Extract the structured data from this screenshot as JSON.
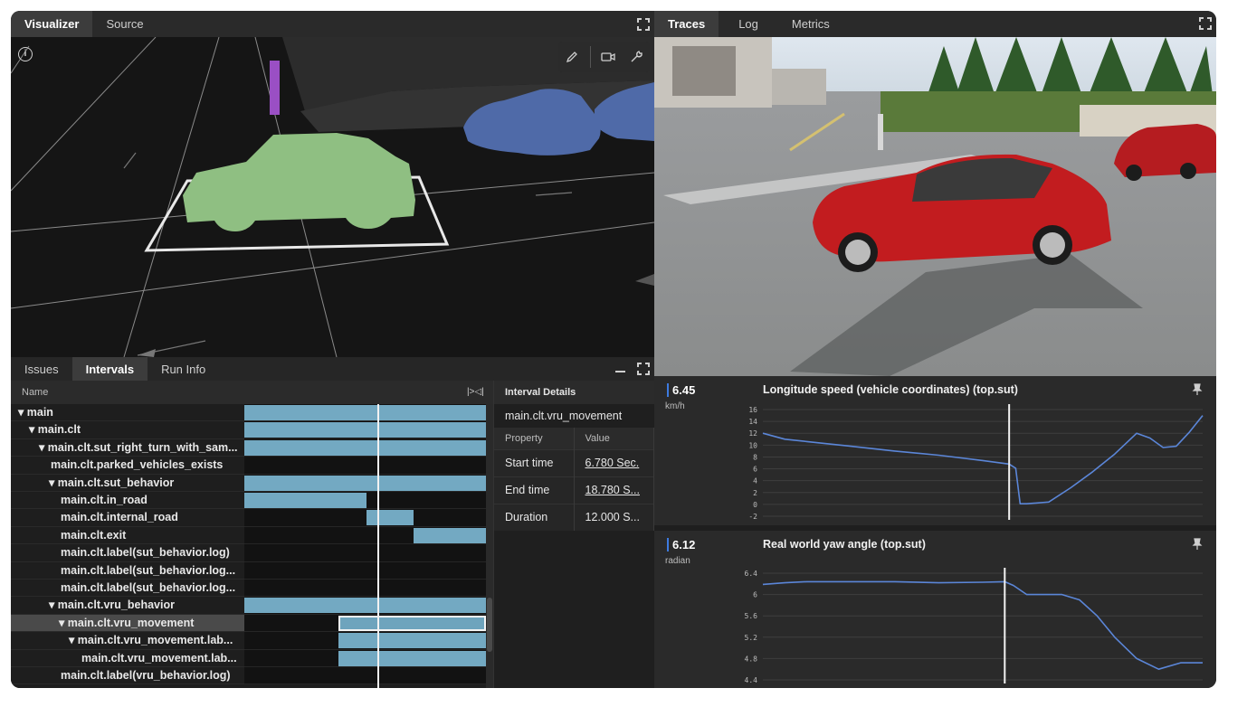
{
  "left_panel": {
    "tabs": [
      {
        "label": "Visualizer",
        "active": true
      },
      {
        "label": "Source",
        "active": false
      }
    ],
    "info_icon": "i"
  },
  "bottom_panel": {
    "tabs": [
      {
        "label": "Issues",
        "active": false
      },
      {
        "label": "Intervals",
        "active": true
      },
      {
        "label": "Run Info",
        "active": false
      }
    ],
    "name_header": "Name",
    "collapse_glyph": "|>◁|",
    "rows": [
      {
        "label": "▾ main",
        "indent": 8,
        "bars": [
          [
            0,
            1
          ]
        ]
      },
      {
        "label": "▾ main.clt",
        "indent": 20,
        "bars": [
          [
            0,
            1
          ]
        ]
      },
      {
        "label": "▾ main.clt.sut_right_turn_with_sam...",
        "indent": 31,
        "bars": [
          [
            0,
            1
          ]
        ]
      },
      {
        "label": "main.clt.parked_vehicles_exists",
        "indent": 44,
        "bars": []
      },
      {
        "label": "▾ main.clt.sut_behavior",
        "indent": 42,
        "bars": [
          [
            0,
            1
          ]
        ]
      },
      {
        "label": "main.clt.in_road",
        "indent": 55,
        "bars": [
          [
            0,
            0.505
          ]
        ]
      },
      {
        "label": "main.clt.internal_road",
        "indent": 55,
        "bars": [
          [
            0.505,
            0.7
          ]
        ]
      },
      {
        "label": "main.clt.exit",
        "indent": 55,
        "bars": [
          [
            0.7,
            1
          ]
        ]
      },
      {
        "label": "main.clt.label(sut_behavior.log)",
        "indent": 55,
        "bars": []
      },
      {
        "label": "main.clt.label(sut_behavior.log...",
        "indent": 55,
        "bars": []
      },
      {
        "label": "main.clt.label(sut_behavior.log...",
        "indent": 55,
        "bars": []
      },
      {
        "label": "▾ main.clt.vru_behavior",
        "indent": 42,
        "bars": [
          [
            0,
            1
          ]
        ]
      },
      {
        "label": "▾ main.clt.vru_movement",
        "indent": 53,
        "bars": [
          [
            0.39,
            1
          ]
        ],
        "selected": true
      },
      {
        "label": "▾ main.clt.vru_movement.lab...",
        "indent": 64,
        "bars": [
          [
            0.39,
            1
          ]
        ]
      },
      {
        "label": "main.clt.vru_movement.lab...",
        "indent": 78,
        "bars": [
          [
            0.39,
            1
          ]
        ]
      },
      {
        "label": "main.clt.label(vru_behavior.log)",
        "indent": 55,
        "bars": []
      }
    ],
    "details": {
      "header": "Interval Details",
      "name": "main.clt.vru_movement",
      "col_property": "Property",
      "col_value": "Value",
      "rows": [
        {
          "property": "Start time",
          "value": "6.780 Sec."
        },
        {
          "property": "End time",
          "value": "18.780 S..."
        },
        {
          "property": "Duration",
          "value": "12.000 S..."
        }
      ]
    }
  },
  "right_panel": {
    "tabs": [
      {
        "label": "Traces",
        "active": true
      },
      {
        "label": "Log",
        "active": false
      },
      {
        "label": "Metrics",
        "active": false
      }
    ]
  },
  "charts": [
    {
      "current_value": "6.45",
      "unit": "km/h",
      "title": "Longitude speed (vehicle coordinates) (top.sut)",
      "y_ticks": [
        "16",
        "14",
        "12",
        "10",
        "8",
        "6",
        "4",
        "2",
        "0",
        "-2"
      ],
      "line_color": "#5b86d8"
    },
    {
      "current_value": "6.12",
      "unit": "radian",
      "title": "Real world yaw angle (top.sut)",
      "y_ticks": [
        "6.4",
        "6",
        "5.6",
        "5.2",
        "4.8",
        "4.4"
      ],
      "line_color": "#5b86d8"
    }
  ],
  "chart_data": [
    {
      "type": "line",
      "title": "Longitude speed (vehicle coordinates) (top.sut)",
      "ylabel": "km/h",
      "ylim": [
        -2,
        16
      ],
      "x": [
        0,
        0.05,
        0.1,
        0.2,
        0.3,
        0.4,
        0.5,
        0.56,
        0.575,
        0.585,
        0.6,
        0.65,
        0.7,
        0.75,
        0.8,
        0.85,
        0.88,
        0.91,
        0.94,
        0.97,
        1.0
      ],
      "series": [
        {
          "values": [
            12.0,
            11.0,
            10.6,
            9.8,
            9.0,
            8.3,
            7.4,
            6.8,
            6.1,
            0.1,
            0.1,
            0.4,
            2.8,
            5.5,
            8.5,
            12.0,
            11.2,
            9.6,
            9.8,
            12.2,
            15.0
          ]
        }
      ],
      "cursor_x": 0.56,
      "grid": true
    },
    {
      "type": "line",
      "title": "Real world yaw angle (top.sut)",
      "ylabel": "radian",
      "ylim": [
        4.4,
        6.4
      ],
      "x": [
        0,
        0.05,
        0.1,
        0.2,
        0.3,
        0.4,
        0.5,
        0.55,
        0.57,
        0.6,
        0.65,
        0.68,
        0.72,
        0.76,
        0.8,
        0.85,
        0.9,
        0.95,
        1.0
      ],
      "series": [
        {
          "values": [
            6.19,
            6.22,
            6.24,
            6.24,
            6.24,
            6.22,
            6.23,
            6.24,
            6.17,
            6.0,
            6.0,
            6.0,
            5.9,
            5.6,
            5.2,
            4.8,
            4.6,
            4.72,
            4.72
          ]
        }
      ],
      "cursor_x": 0.55,
      "grid": true
    }
  ]
}
